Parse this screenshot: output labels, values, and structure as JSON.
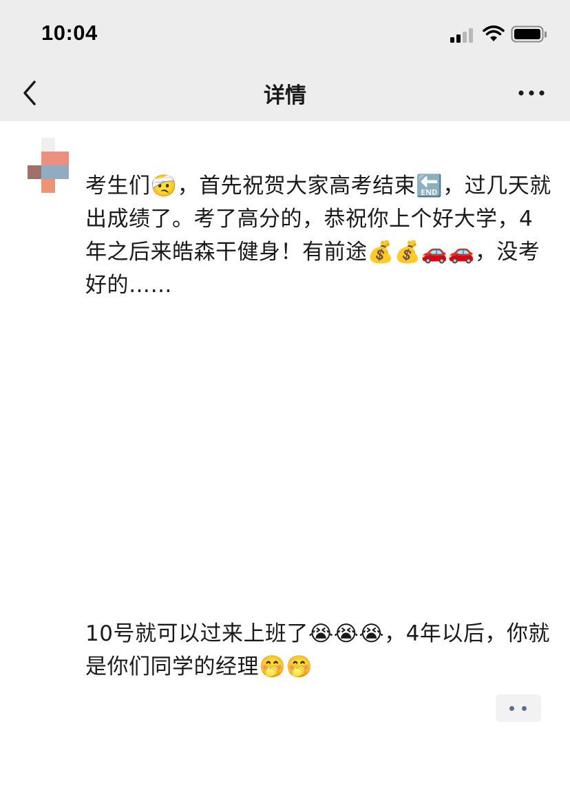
{
  "status_bar": {
    "time": "10:04"
  },
  "nav": {
    "title": "详情"
  },
  "post": {
    "paragraph1": "考生们🤕，首先祝贺大家高考结束🔚，过几天就出成绩了。考了高分的，恭祝你上个好大学，4年之后来皓森干健身！有前途💰💰🚗🚗，没考好的……",
    "paragraph2": "10号就可以过来上班了😭😭😭，4年以后，你就是你们同学的经理🤭🤭"
  },
  "colors": {
    "header_bg": "#ededed",
    "link_blue": "#5d6e93",
    "text": "#1a1a1a"
  }
}
